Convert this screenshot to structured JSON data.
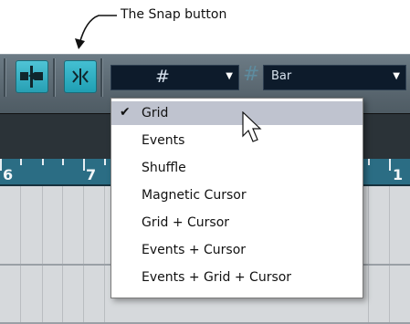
{
  "callout": {
    "text": "The Snap button"
  },
  "toolbar": {
    "snap_type_value": "#",
    "quantize_value": "Bar"
  },
  "ruler": {
    "labels": [
      "6",
      "7",
      "1"
    ]
  },
  "snap_menu": {
    "items": [
      {
        "label": "Grid",
        "checked": true,
        "highlighted": true
      },
      {
        "label": "Events"
      },
      {
        "label": "Shuffle"
      },
      {
        "label": "Magnetic Cursor"
      },
      {
        "label": "Grid + Cursor"
      },
      {
        "label": "Events + Cursor"
      },
      {
        "label": "Events + Grid + Cursor"
      }
    ]
  },
  "colors": {
    "accent": "#279fb3",
    "ruler": "#2b6d84",
    "highlight": "#bfc3cf"
  }
}
